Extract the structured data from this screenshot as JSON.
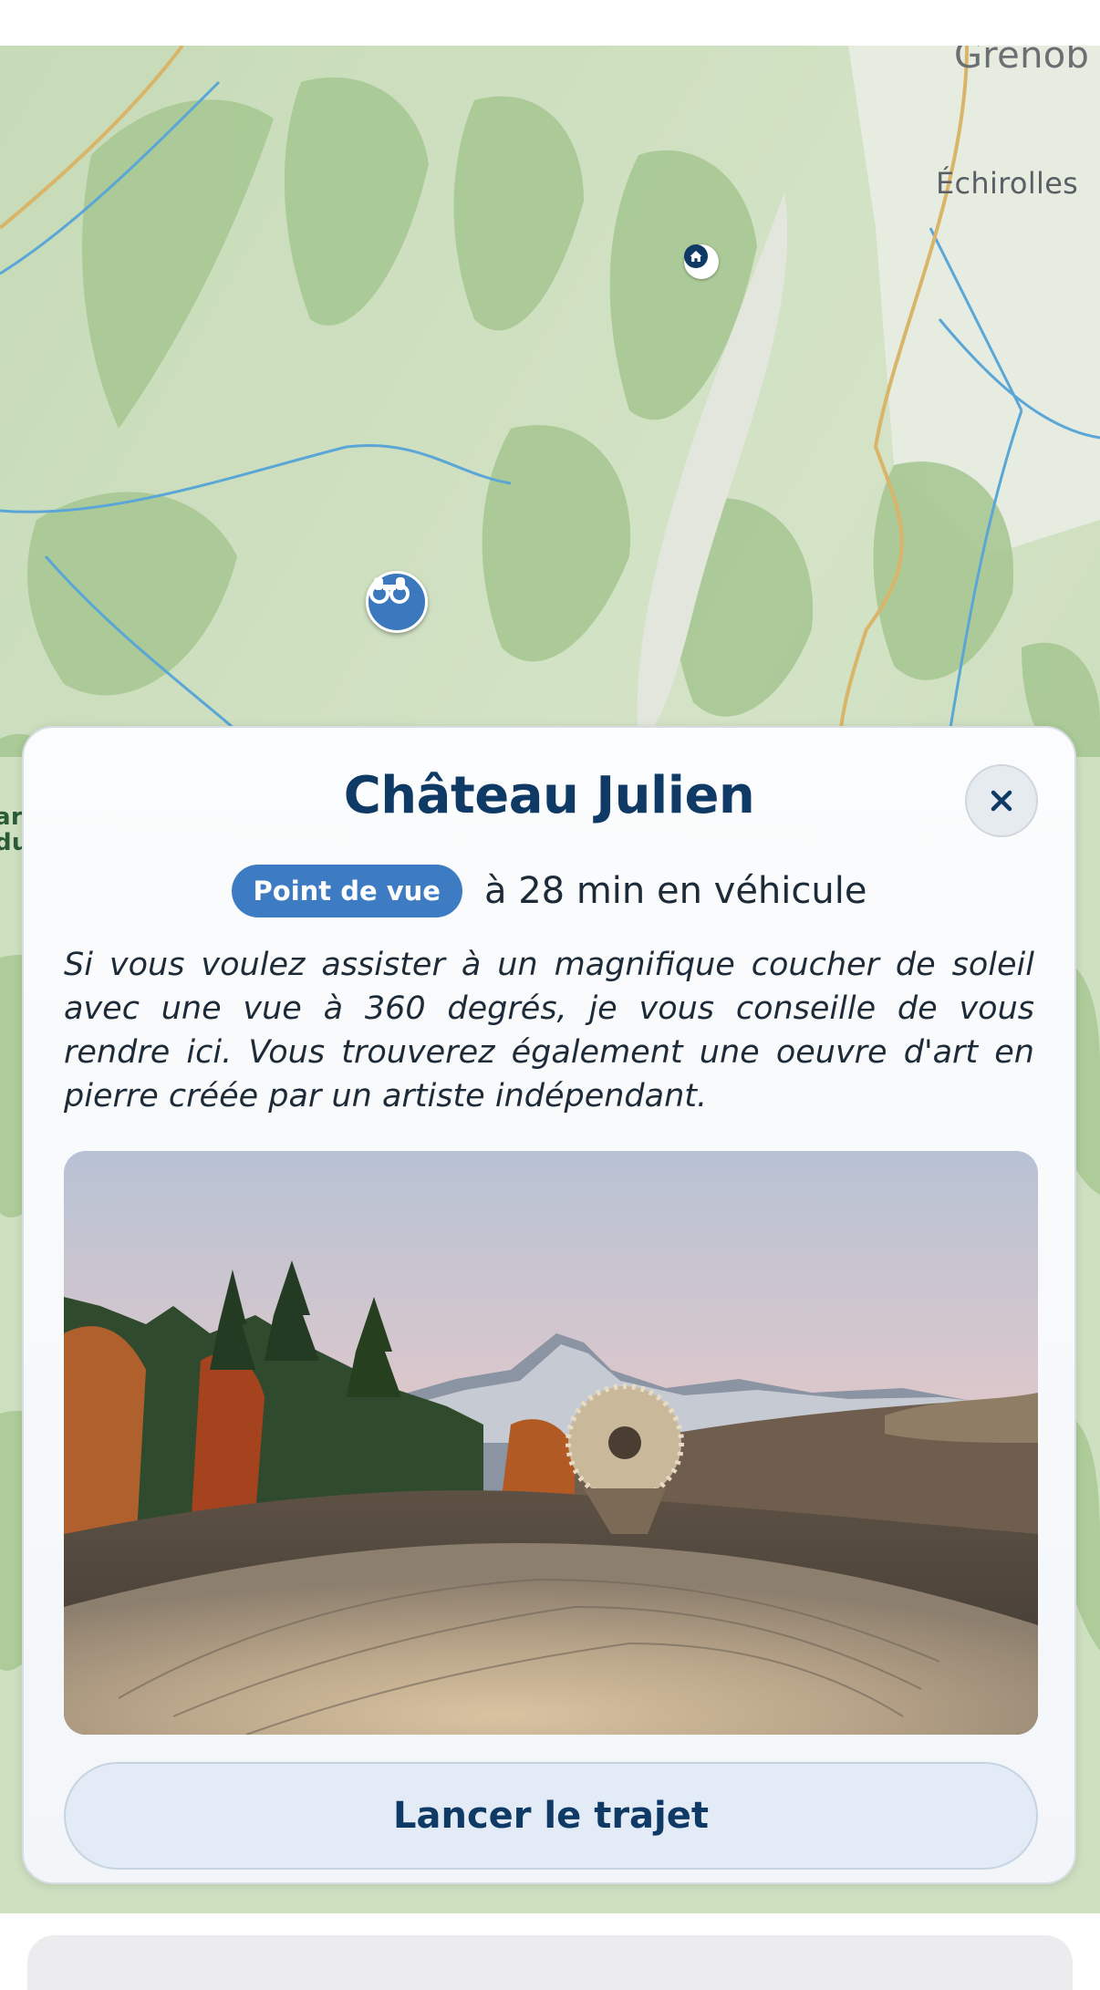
{
  "map": {
    "labels": {
      "grenoble": "Grenob",
      "echirolles": "Échirolles",
      "side": "arc\ndu"
    },
    "pins": [
      {
        "icon": "home-icon"
      },
      {
        "icon": "binoculars-icon"
      }
    ],
    "colors": {
      "terrain": "#cfe0c1",
      "forest": "#a9c996",
      "water": "#5aa6d6",
      "road": "#d9b56a"
    }
  },
  "card": {
    "title": "Château Julien",
    "badge": "Point de vue",
    "duration": "à 28 min en véhicule",
    "description": "Si vous voulez assister à un magnifique coucher de soleil avec une vue à 360 degrés, je vous conseille de vous rendre ici. Vous trouverez également une oeuvre d'art en pierre créée par un artiste indépendant.",
    "cta_label": "Lancer le trajet",
    "close_icon": "close-icon",
    "accent": "#3d7cc2",
    "title_color": "#0f3a66"
  }
}
